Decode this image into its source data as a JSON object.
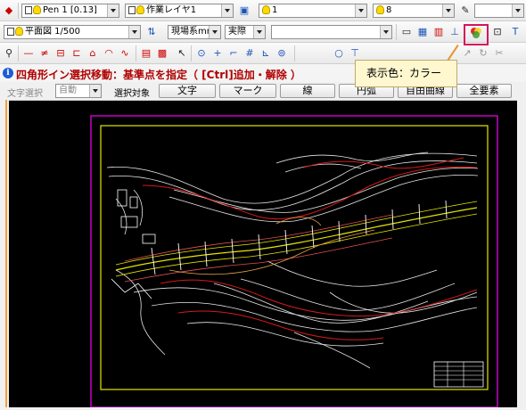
{
  "toolbar1": {
    "pen_combo": "Pen 1 [0.13]",
    "layer_combo": "作業レイヤ1",
    "line_combo": "1",
    "weight_combo": "8"
  },
  "toolbar2": {
    "view_combo": "平面図 1/500",
    "coord_combo": "現場系mm",
    "scale_combo": "実際",
    "blank_combo": ""
  },
  "message": {
    "info_mark": "i",
    "text": "四角形イン選択移動：基準点を指定（ [Ctrl]追加・解除 ）"
  },
  "selection": {
    "text_select_label": "文字選択",
    "text_select_value": "自動",
    "target_label": "選択対象",
    "buttons": [
      "文字",
      "マーク",
      "線",
      "円弧",
      "自由曲線",
      "全要素"
    ]
  },
  "tooltip": {
    "text": "表示色：カラー"
  },
  "colors": {
    "message_red": "#b00000",
    "highlight": "#d4145a",
    "tooltip_bg": "#fff8cf",
    "canvas_bg": "#000000",
    "frame_magenta": "#c800c8",
    "frame_yellow": "#e6e600"
  },
  "icons": [
    "eraser-icon",
    "pen-swatch-icon",
    "layer-icon",
    "color-display-icon",
    "pointer-icon",
    "snap-icon"
  ]
}
